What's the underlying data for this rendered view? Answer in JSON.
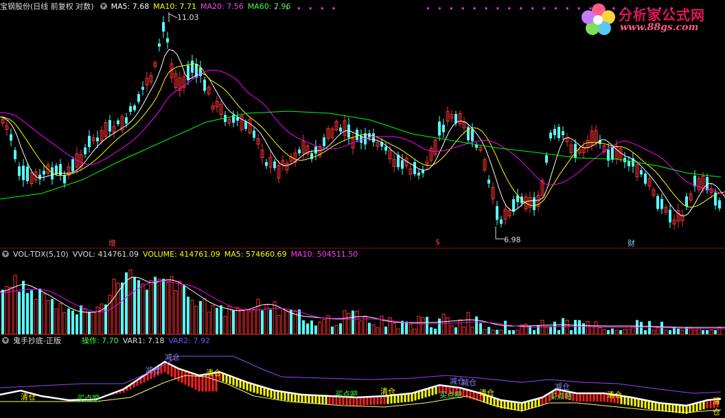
{
  "main_panel": {
    "stock_name": "宝钢股份(日线 前复权 对数)",
    "ma5": {
      "label": "MA5: 7.68",
      "color": "#ffffff"
    },
    "ma10": {
      "label": "MA10: 7.71",
      "color": "#ffff00"
    },
    "ma20": {
      "label": "MA20: 7.56",
      "color": "#ff00ff"
    },
    "ma60": {
      "label": "MA60: 7.96",
      "color": "#00ff00"
    },
    "high_label": "11.03",
    "low_label": "6.98",
    "markers": [
      {
        "text": "增",
        "color": "#ff4040"
      },
      {
        "text": "$",
        "color": "#ff4040"
      },
      {
        "text": "财",
        "color": "#7fd0ff"
      }
    ]
  },
  "logo": {
    "title": "分析家公式网",
    "url": "www.88gs.com"
  },
  "vol_panel": {
    "name": "VOL-TDX(5,10)",
    "vvol": "VVOL: 414761.09",
    "volume": {
      "label": "VOLUME: 414761.09",
      "color": "#ffff00"
    },
    "ma5": {
      "label": "MA5: 574660.69",
      "color": "#ffff00"
    },
    "ma10": {
      "label": "MA10: 504511.50",
      "color": "#ff00ff"
    }
  },
  "ind_panel": {
    "name": "鬼手抄底-正版",
    "op": {
      "label": "操作: 7.70",
      "color": "#00ff00"
    },
    "var1": {
      "label": "VAR1: 7.18",
      "color": "#ffffff"
    },
    "var2": {
      "label": "VAR2: 7.92",
      "color": "#4040ff"
    },
    "signals": [
      {
        "text": "清仓",
        "color": "#ffff00"
      },
      {
        "text": "买点吧",
        "color": "#00ff00"
      },
      {
        "text": "减仓",
        "color": "#8080ff"
      },
      {
        "text": "减仓",
        "color": "#8080ff"
      },
      {
        "text": "清仓",
        "color": "#ffff00"
      },
      {
        "text": "买点吧",
        "color": "#00ff00"
      },
      {
        "text": "清仓",
        "color": "#ffff00"
      },
      {
        "text": "减仓",
        "color": "#8080ff"
      },
      {
        "text": "买点吧",
        "color": "#00ff00"
      },
      {
        "text": "减仓",
        "color": "#8080ff"
      },
      {
        "text": "清仓",
        "color": "#ffff00"
      },
      {
        "text": "减仓",
        "color": "#8080ff"
      },
      {
        "text": "买点吧",
        "color": "#00ff00"
      },
      {
        "text": "清仓",
        "color": "#ffff00"
      },
      {
        "text": "清仓",
        "color": "#ffff00"
      }
    ]
  },
  "colors": {
    "up": "#ff3232",
    "down": "#54ffff",
    "grid": "#8a1010"
  }
}
